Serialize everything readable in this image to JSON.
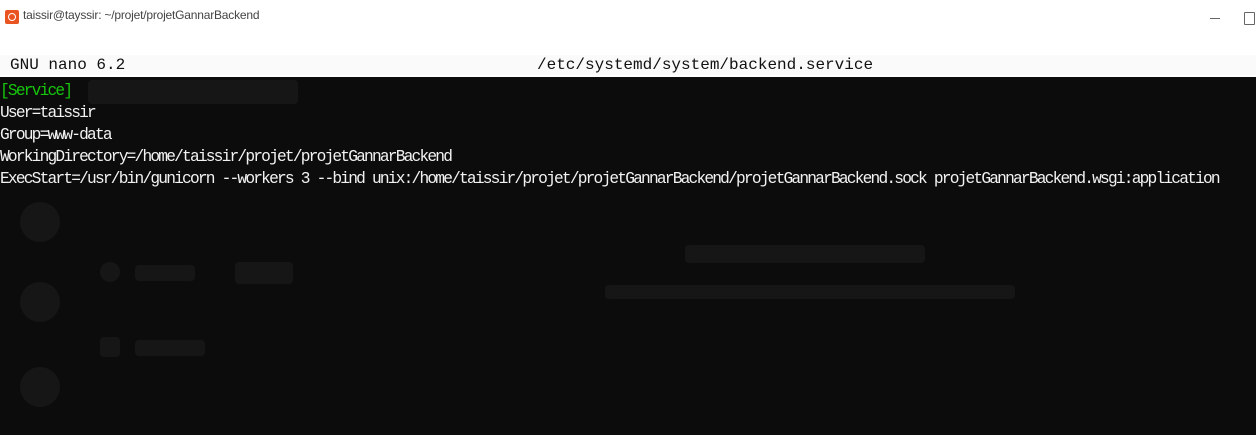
{
  "window": {
    "title": "taissir@tayssir: ~/projet/projetGannarBackend",
    "app_icon": "ubuntu-terminal-icon",
    "controls": [
      "minimize-icon",
      "maximize-icon"
    ]
  },
  "nano": {
    "version": "GNU nano 6.2",
    "file_path": "/etc/systemd/system/backend.service"
  },
  "editor": {
    "lines": [
      "[Service]",
      "User=taissir",
      "Group=www-data",
      "WorkingDirectory=/home/taissir/projet/projetGannarBackend",
      "ExecStart=/usr/bin/gunicorn --workers 3 --bind unix:/home/taissir/projet/projetGannarBackend/projetGannarBackend.sock projetGannarBackend.wsgi:application"
    ]
  },
  "colors": {
    "terminal_bg": "#0c0c0c",
    "text": "#f2f2f2",
    "section_header": "#16c60c",
    "header_bar_bg": "#fafafa",
    "icon_accent": "#e95420"
  }
}
